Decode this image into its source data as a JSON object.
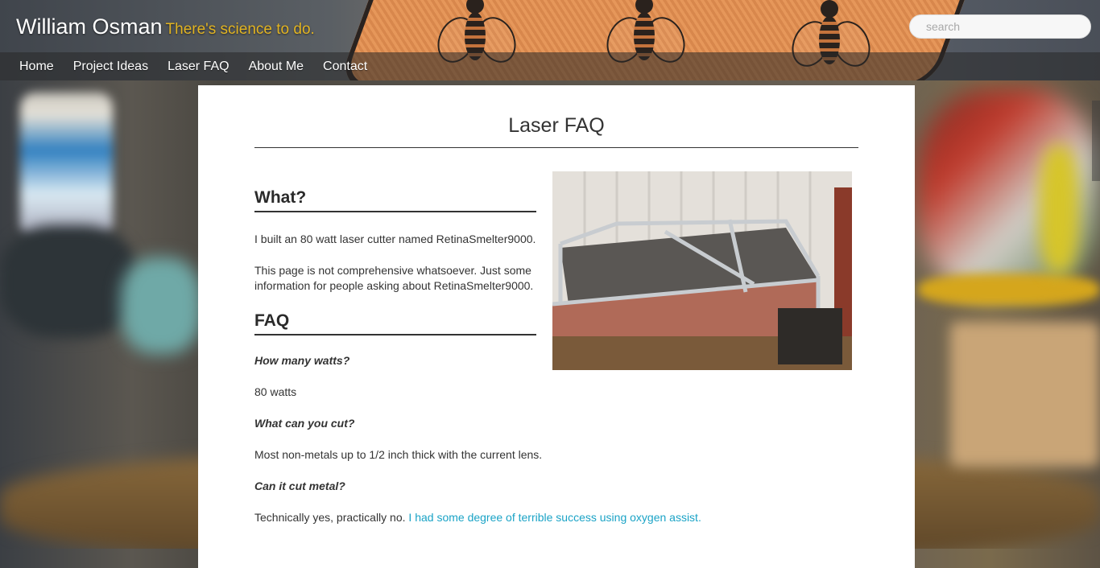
{
  "header": {
    "site_name": "William Osman",
    "tagline": "There's science to do.",
    "search_placeholder": "search"
  },
  "nav": {
    "items": [
      "Home",
      "Project Ideas",
      "Laser FAQ",
      "About Me",
      "Contact"
    ]
  },
  "page": {
    "title": "Laser FAQ",
    "what_heading": "What?",
    "what_p1": "I built an 80 watt laser cutter named RetinaSmelter9000.",
    "what_p2": "This page is not comprehensive whatsoever. Just some information for people asking about RetinaSmelter9000.",
    "faq_heading": "FAQ",
    "faq": [
      {
        "q": "How many watts?",
        "a": "80 watts"
      },
      {
        "q": "What can you cut?",
        "a": "Most non-metals up to 1/2 inch thick with the current lens."
      },
      {
        "q": "Can it cut metal?",
        "a_prefix": "Technically yes, practically no. ",
        "a_link": "I had some degree of terrible success using oxygen assist."
      }
    ]
  }
}
